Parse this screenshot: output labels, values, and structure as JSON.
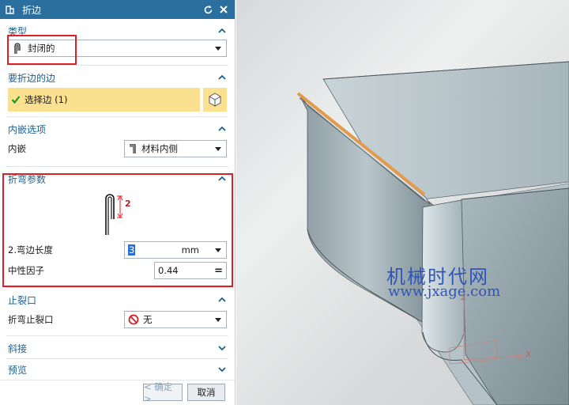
{
  "titlebar": {
    "title": "折边"
  },
  "sections": {
    "type": {
      "header": "类型",
      "value": "封闭的"
    },
    "edge": {
      "header": "要折边的边",
      "selection": "选择边 (1)"
    },
    "inset": {
      "header": "内嵌选项",
      "label": "内嵌",
      "value": "材料内侧"
    },
    "bend": {
      "header": "折弯参数",
      "dim_label": "2",
      "length_label": "2.弯边长度",
      "length_value": "3",
      "length_unit": "mm",
      "neutral_label": "中性因子",
      "neutral_value": "0.44"
    },
    "relief": {
      "header": "止裂口",
      "label": "折弯止裂口",
      "value": "无"
    },
    "miter": {
      "header": "斜接"
    },
    "preview": {
      "header": "预览"
    }
  },
  "buttons": {
    "ok": "< 确定 >",
    "cancel": "取消"
  },
  "view": {
    "watermark_cn": "机械时代网",
    "watermark_url": "www.jxage.com",
    "axis_x": "X",
    "axis_z": "Z"
  },
  "colors": {
    "accent": "#1e5f91",
    "titlebar": "#2a6f9e",
    "highlight": "#fbe08f",
    "annotation": "#e01e26"
  }
}
